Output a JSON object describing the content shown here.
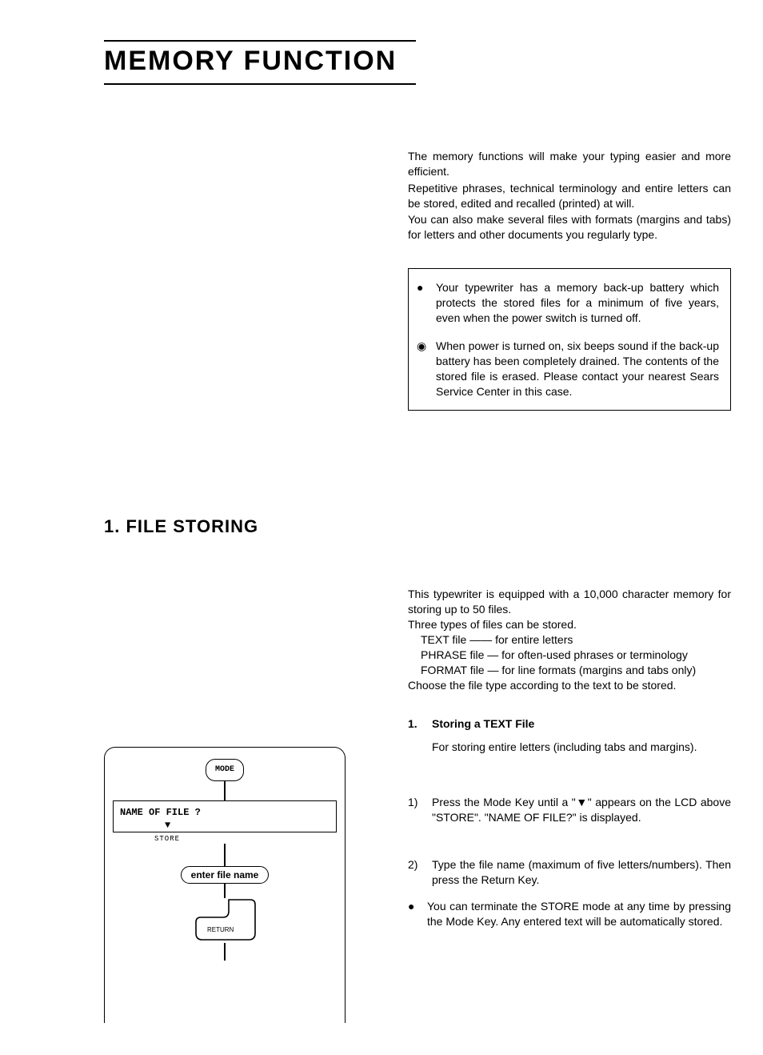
{
  "title": "MEMORY FUNCTION",
  "intro": {
    "p1": "The memory functions will make your typing easier and more efficient.",
    "p2": "Repetitive phrases, technical terminology and entire letters can be stored, edited and recalled (printed) at will.",
    "p3": "You can also make several files with formats (margins and tabs) for letters and other documents you regularly type."
  },
  "notes": {
    "n1": "Your typewriter has a memory back-up battery which protects the stored files for a minimum of five years, even when the power switch is turned off.",
    "n2": "When power is turned on, six beeps sound if the back-up battery has been completely drained. The contents of the stored file is erased. Please contact your nearest Sears Service Center in this case."
  },
  "section1": {
    "heading": "1.   FILE STORING",
    "intro1": "This typewriter is equipped with a 10,000 character memory for storing up to 50 files.",
    "intro2": "Three types of files can be stored.",
    "types": {
      "t1": "TEXT file —— for entire letters",
      "t2": "PHRASE file — for often-used phrases or terminology",
      "t3": "FORMAT file — for line formats (margins and tabs only)"
    },
    "intro3": "Choose the file type according to the text to be stored.",
    "sub": {
      "num": "1.",
      "title": "Storing a TEXT File",
      "desc": "For storing entire letters (including tabs and margins).",
      "step1_num": "1)",
      "step1": "Press the Mode Key until a \"▼\" appears on the LCD above \"STORE\". \"NAME OF FILE?\" is displayed.",
      "step2_num": "2)",
      "step2": "Type the file name (maximum of five letters/numbers). Then press the Return Key.",
      "note": "You can terminate the STORE mode at any time by pressing the Mode Key. Any entered text will be automatically stored."
    }
  },
  "diagram": {
    "mode": "MODE",
    "lcd": "NAME OF FILE ?",
    "arrow": "▼",
    "store": "STORE",
    "enter": "enter file name",
    "return": "RETURN"
  }
}
